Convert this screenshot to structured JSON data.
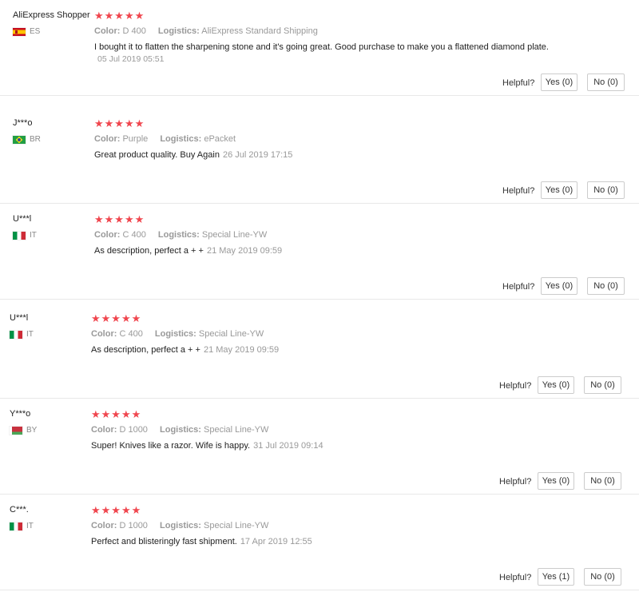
{
  "helpful_label": "Helpful?",
  "color_key": "Color:",
  "logistics_key": "Logistics:",
  "stars": "★★★★★",
  "reviews": [
    {
      "user": "AliExpress Shopper",
      "flag": "es",
      "country": "ES",
      "color": "D 400",
      "logistics": "AliExpress Standard Shipping",
      "text": "I bought it to flatten the sharpening stone and it's going great. Good purchase to make you a flattened diamond plate.",
      "date": "05 Jul 2019 05:51",
      "yes": "Yes (0)",
      "no": "No (0)"
    },
    {
      "user": "J***o",
      "flag": "br",
      "country": "BR",
      "color": "Purple",
      "logistics": "ePacket",
      "text": "Great product quality. Buy Again",
      "date": "26 Jul 2019 17:15",
      "yes": "Yes (0)",
      "no": "No (0)"
    },
    {
      "user": "U***l",
      "flag": "it",
      "country": "IT",
      "color": "C 400",
      "logistics": "Special Line-YW",
      "text": "As description, perfect a + +",
      "date": "21 May 2019 09:59",
      "yes": "Yes (0)",
      "no": "No (0)"
    },
    {
      "user": "U***l",
      "flag": "it",
      "country": "IT",
      "color": "C 400",
      "logistics": "Special Line-YW",
      "text": "As description, perfect a + +",
      "date": "21 May 2019 09:59",
      "yes": "Yes (0)",
      "no": "No (0)"
    },
    {
      "user": "Y***o",
      "flag": "by",
      "country": "BY",
      "color": "D 1000",
      "logistics": "Special Line-YW",
      "text": "Super! Knives like a razor. Wife is happy.",
      "date": "31 Jul 2019 09:14",
      "yes": "Yes (0)",
      "no": "No (0)"
    },
    {
      "user": "C***.",
      "flag": "it",
      "country": "IT",
      "color": "D 1000",
      "logistics": "Special Line-YW",
      "text": "Perfect and blisteringly fast shipment.",
      "date": "17 Apr 2019 12:55",
      "yes": "Yes (1)",
      "no": "No (0)"
    }
  ]
}
